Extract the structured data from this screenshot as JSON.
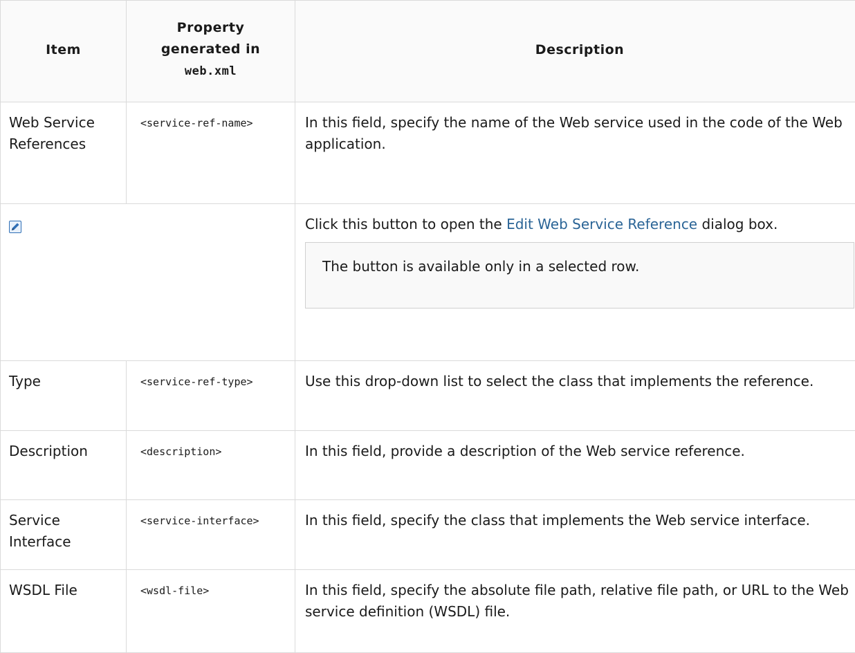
{
  "headers": {
    "item": "Item",
    "property_line1": "Property",
    "property_line2": "generated in",
    "property_code": "web.xml",
    "description": "Description"
  },
  "rows": [
    {
      "item": "Web Service References",
      "property": "<service-ref-name>",
      "description": "In this field, specify the name of the Web service used in the code of the Web application."
    },
    {
      "icon": "edit-icon",
      "description_pre": "Click this button to open the ",
      "description_link": "Edit Web Service Reference",
      "description_post": " dialog box.",
      "note": "The button is available only in a selected row."
    },
    {
      "item": "Type",
      "property": "<service-ref-type>",
      "description": "Use this drop-down list to select the class that implements the reference."
    },
    {
      "item": "Description",
      "property": "<description>",
      "description": "In this field, provide a description of the Web service reference."
    },
    {
      "item": "Service Interface",
      "property": "<service-interface>",
      "description": "In this field, specify the class that implements the Web service interface."
    },
    {
      "item": "WSDL File",
      "property": "<wsdl-file>",
      "description": "In this field, specify the absolute file path, relative file path, or URL to the Web service definition (WSDL) file."
    }
  ],
  "colors": {
    "link": "#2a6496",
    "border": "#dadada",
    "header_bg": "#fafafa",
    "icon_blue": "#2f6fb6"
  }
}
